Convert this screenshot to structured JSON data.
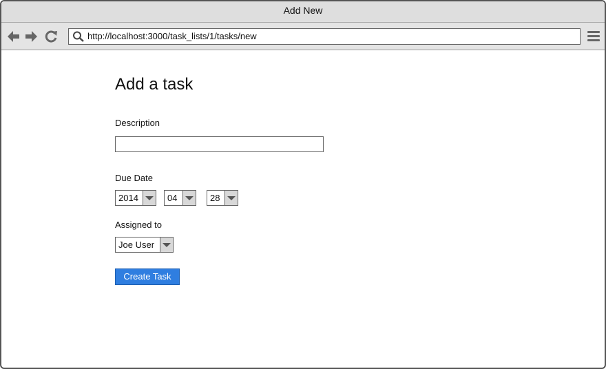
{
  "window": {
    "title": "Add New"
  },
  "toolbar": {
    "back_icon": "arrow-left-icon",
    "forward_icon": "arrow-right-icon",
    "reload_icon": "reload-icon",
    "search_icon": "search-icon",
    "menu_icon": "hamburger-menu-icon",
    "url": "http://localhost:3000/task_lists/1/tasks/new"
  },
  "form": {
    "title": "Add a task",
    "description_label": "Description",
    "description_value": "",
    "due_date_label": "Due Date",
    "due_year": "2014",
    "due_month": "04",
    "due_day": "28",
    "assigned_label": "Assigned to",
    "assigned_value": "Joe User",
    "submit_label": "Create Task"
  },
  "colors": {
    "button_bg": "#2f7ee0",
    "titlebar_bg": "#dedede"
  }
}
